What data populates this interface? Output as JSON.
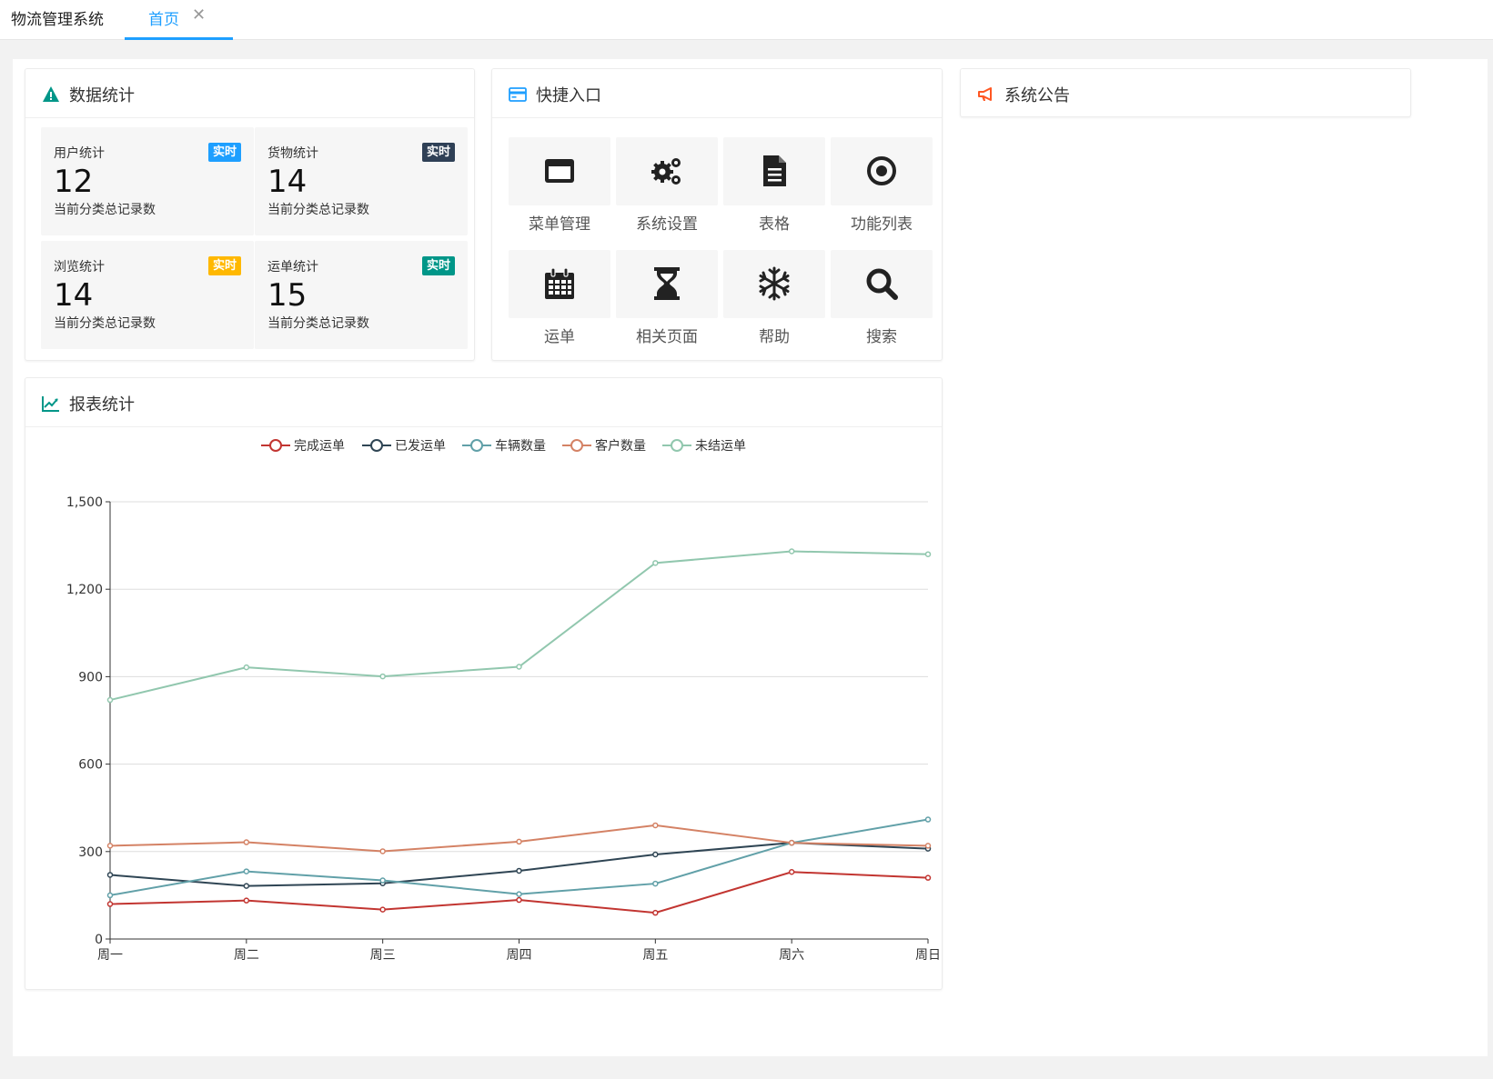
{
  "app": {
    "title": "物流管理系统"
  },
  "tabs": [
    {
      "label": "首页",
      "close": "✕"
    }
  ],
  "stats_card": {
    "title": "数据统计",
    "items": [
      {
        "name": "用户统计",
        "badge": "实时",
        "badge_color": "#1e9fff",
        "value": "12",
        "desc": "当前分类总记录数"
      },
      {
        "name": "货物统计",
        "badge": "实时",
        "badge_color": "#2f4056",
        "value": "14",
        "desc": "当前分类总记录数"
      },
      {
        "name": "浏览统计",
        "badge": "实时",
        "badge_color": "#ffb800",
        "value": "14",
        "desc": "当前分类总记录数"
      },
      {
        "name": "运单统计",
        "badge": "实时",
        "badge_color": "#009688",
        "value": "15",
        "desc": "当前分类总记录数"
      }
    ]
  },
  "quick_card": {
    "title": "快捷入口",
    "items": [
      {
        "label": "菜单管理",
        "icon": "window-icon"
      },
      {
        "label": "系统设置",
        "icon": "gears-icon"
      },
      {
        "label": "表格",
        "icon": "document-icon"
      },
      {
        "label": "功能列表",
        "icon": "dot-circle-icon"
      },
      {
        "label": "运单",
        "icon": "calendar-icon"
      },
      {
        "label": "相关页面",
        "icon": "hourglass-icon"
      },
      {
        "label": "帮助",
        "icon": "snowflake-icon"
      },
      {
        "label": "搜索",
        "icon": "search-icon"
      }
    ]
  },
  "notice_card": {
    "title": "系统公告"
  },
  "report_card": {
    "title": "报表统计"
  },
  "colors": {
    "accent": "#1e9fff",
    "warning": "#009688",
    "notice": "#ff5722"
  },
  "chart_data": {
    "type": "line",
    "categories": [
      "周一",
      "周二",
      "周三",
      "周四",
      "周五",
      "周六",
      "周日"
    ],
    "ylim": [
      0,
      1500
    ],
    "yticks": [
      0,
      300,
      600,
      900,
      1200,
      1500
    ],
    "ytick_labels": [
      "0",
      "300",
      "600",
      "900",
      "1,200",
      "1,500"
    ],
    "grid": true,
    "legend_position": "top-center",
    "series": [
      {
        "name": "完成运单",
        "color": "#c23531",
        "values": [
          120,
          132,
          101,
          134,
          90,
          230,
          210
        ]
      },
      {
        "name": "已发运单",
        "color": "#2f4554",
        "values": [
          220,
          182,
          191,
          234,
          290,
          330,
          310
        ]
      },
      {
        "name": "车辆数量",
        "color": "#61a0a8",
        "values": [
          150,
          232,
          201,
          154,
          190,
          330,
          410
        ]
      },
      {
        "name": "客户数量",
        "color": "#d48265",
        "values": [
          320,
          332,
          301,
          334,
          390,
          330,
          320
        ]
      },
      {
        "name": "未结运单",
        "color": "#91c7ae",
        "values": [
          820,
          932,
          901,
          934,
          1290,
          1330,
          1320
        ]
      }
    ]
  }
}
